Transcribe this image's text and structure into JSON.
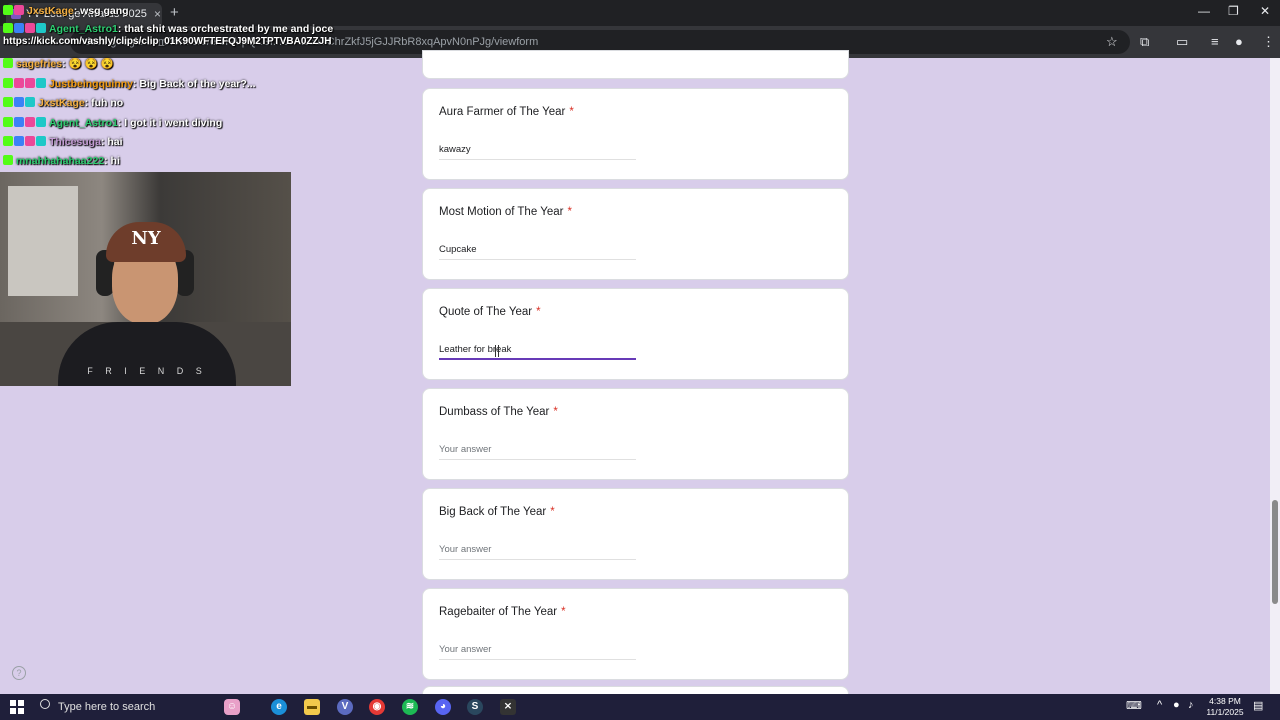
{
  "browser": {
    "tab_title": "YV Lounge Awards 2025",
    "tab_close": "×",
    "new_tab": "+",
    "address": "docs.google.com/forms/d/e/1FAIpQLSf...oJAEcuTChrZkfJ5jGJJRbR8xqApvN0nPJg/viewform",
    "window_controls": [
      "—",
      "❐",
      "✕"
    ]
  },
  "chat": {
    "messages": [
      {
        "user": "JxstKage",
        "user_color": "#f5b041",
        "text": ": wsg gang"
      },
      {
        "user": "Agent_Astro1",
        "user_color": "#2ecc71",
        "text": ": that shit was orchestrated by me and joce"
      },
      {
        "user": "sagefries",
        "user_color": "#f5b041",
        "text": ": 😵 😵 😵"
      },
      {
        "user": "Justbeingquinny",
        "user_color": "#f39c12",
        "text": ": Big Back of the year?..."
      },
      {
        "user": "JxstKage",
        "user_color": "#f5b041",
        "text": ": fuh no"
      },
      {
        "user": "Agent_Astro1",
        "user_color": "#2ecc71",
        "text": ": I got it i went diving"
      },
      {
        "user": "Thicesuga",
        "user_color": "#c39bd3",
        "text": ": hai"
      },
      {
        "user": "mnahhahahaa222",
        "user_color": "#2ecc71",
        "text": ": hi"
      }
    ],
    "clip_url": "https://kick.com/vashly/clips/clip_01K90WFTEFQJ9M2TPTVBA0ZZJH"
  },
  "webcam": {
    "cap_logo": "NY",
    "shirt_text": "F R I E N D S"
  },
  "form": {
    "required_mark": "*",
    "questions": [
      {
        "title": "Aura Farmer of The Year",
        "answer": "kawazy",
        "placeholder": "Your answer"
      },
      {
        "title": "Most Motion of The Year",
        "answer": "Cupcake",
        "placeholder": "Your answer"
      },
      {
        "title": "Quote of The Year",
        "answer": "Leather for break",
        "placeholder": "Your answer"
      },
      {
        "title": "Dumbass of The Year",
        "answer": "",
        "placeholder": "Your answer"
      },
      {
        "title": "Big Back of The Year",
        "answer": "",
        "placeholder": "Your answer"
      },
      {
        "title": "Ragebaiter of The Year",
        "answer": "",
        "placeholder": "Your answer"
      }
    ],
    "help": "?"
  },
  "taskbar": {
    "search_placeholder": "Type here to search",
    "time": "4:38 PM",
    "date": "11/1/2025",
    "apps": [
      {
        "name": "edge",
        "color": "#1b8fd8",
        "glyph": "e"
      },
      {
        "name": "files",
        "color": "#f2c94c",
        "glyph": "▬"
      },
      {
        "name": "vpn",
        "color": "#5c6bc0",
        "glyph": "V"
      },
      {
        "name": "chrome",
        "color": "#e53935",
        "glyph": "◉"
      },
      {
        "name": "spotify",
        "color": "#1db954",
        "glyph": "≋"
      },
      {
        "name": "discord",
        "color": "#5865f2",
        "glyph": "◕"
      },
      {
        "name": "steam",
        "color": "#2a475e",
        "glyph": "S"
      },
      {
        "name": "xbox",
        "color": "#333333",
        "glyph": "⨯"
      }
    ]
  }
}
